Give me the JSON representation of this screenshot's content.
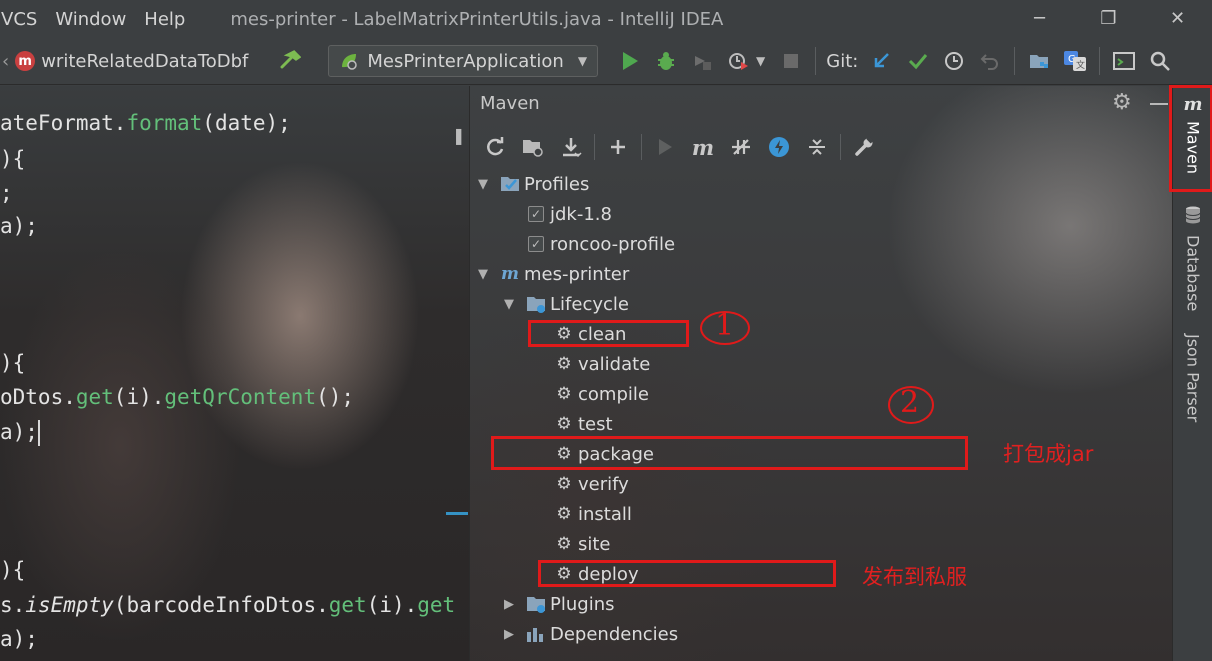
{
  "menu": [
    "VCS",
    "Window",
    "Help"
  ],
  "window_title": "mes-printer - LabelMatrixPrinterUtils.java - IntelliJ IDEA",
  "window_controls": {
    "minimize": "─",
    "restore": "❐",
    "close": "✕"
  },
  "toolbar": {
    "nav_method": "writeRelatedDataToDbf",
    "run_config": "MesPrinterApplication",
    "git_label": "Git:"
  },
  "editor": {
    "lines": [
      {
        "a": "ateFormat.",
        "fn": "format",
        "b": "(date);"
      },
      {
        "a": "){",
        "fn": "",
        "b": ""
      },
      {
        "a": ";",
        "fn": "",
        "b": ""
      },
      {
        "a": "a);",
        "fn": "",
        "b": ""
      },
      {
        "a": "){",
        "fn": "",
        "b": ""
      },
      {
        "a": "oDtos.",
        "fn": "get",
        "b": "(i).",
        "fn2": "getQrContent",
        "c": "();"
      },
      {
        "a": "a);",
        "fn": "",
        "b": ""
      },
      {
        "a": "){",
        "fn": "",
        "b": ""
      },
      {
        "a": "s.",
        "it": "isEmpty",
        "b": "(barcodeInfoDtos.",
        "fn": "get",
        "c": "(i).",
        "fn2": "get"
      },
      {
        "a": "a);",
        "fn": "",
        "b": ""
      }
    ]
  },
  "maven": {
    "title": "Maven",
    "tree": {
      "profiles": "Profiles",
      "profile_items": [
        "jdk-1.8",
        "roncoo-profile"
      ],
      "project": "mes-printer",
      "lifecycle": "Lifecycle",
      "phases": [
        "clean",
        "validate",
        "compile",
        "test",
        "package",
        "verify",
        "install",
        "site",
        "deploy"
      ],
      "plugins": "Plugins",
      "dependencies": "Dependencies"
    }
  },
  "annotations": {
    "num1": "1",
    "num2": "2",
    "package_note": "打包成jar",
    "deploy_note": "发布到私服"
  },
  "right_stripe": [
    "Maven",
    "Database",
    "Json Parser"
  ],
  "colors": {
    "annotation_red": "#e01a1a",
    "code_method_green": "#63bf7a",
    "ide_bg": "#3c3f41"
  }
}
